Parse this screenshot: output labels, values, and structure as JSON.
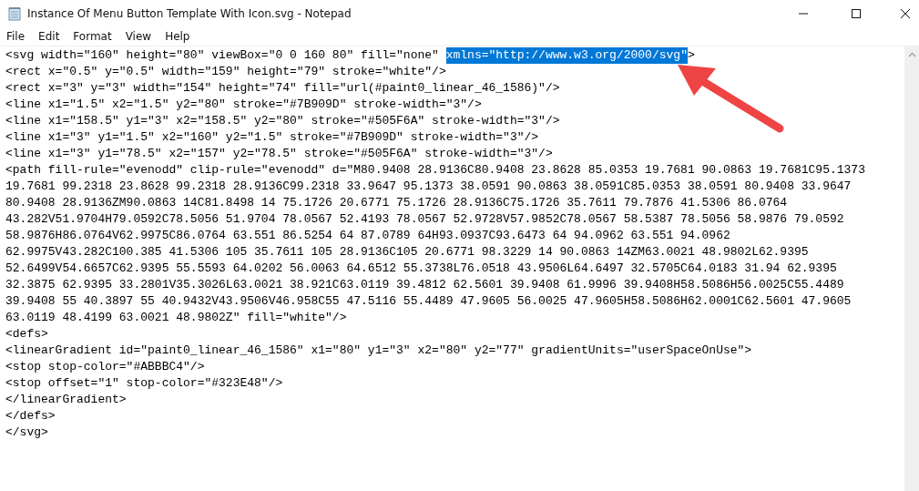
{
  "window": {
    "title": "Instance Of Menu Button Template With Icon.svg - Notepad"
  },
  "menu": [
    "File",
    "Edit",
    "Format",
    "View",
    "Help"
  ],
  "editor": {
    "lines": [
      {
        "segments": [
          {
            "text": "<svg width=\"160\" height=\"80\" viewBox=\"0 0 160 80\" fill=\"none\" ",
            "selected": false
          },
          {
            "text": "xmlns=\"http://www.w3.org/2000/svg\"",
            "selected": true
          },
          {
            "text": ">",
            "selected": false
          }
        ]
      },
      {
        "text": "<rect x=\"0.5\" y=\"0.5\" width=\"159\" height=\"79\" stroke=\"white\"/>"
      },
      {
        "text": "<rect x=\"3\" y=\"3\" width=\"154\" height=\"74\" fill=\"url(#paint0_linear_46_1586)\"/>"
      },
      {
        "text": "<line x1=\"1.5\" x2=\"1.5\" y2=\"80\" stroke=\"#7B909D\" stroke-width=\"3\"/>"
      },
      {
        "text": "<line x1=\"158.5\" y1=\"3\" x2=\"158.5\" y2=\"80\" stroke=\"#505F6A\" stroke-width=\"3\"/>"
      },
      {
        "text": "<line x1=\"3\" y1=\"1.5\" x2=\"160\" y2=\"1.5\" stroke=\"#7B909D\" stroke-width=\"3\"/>"
      },
      {
        "text": "<line x1=\"3\" y1=\"78.5\" x2=\"157\" y2=\"78.5\" stroke=\"#505F6A\" stroke-width=\"3\"/>"
      },
      {
        "text": "<path fill-rule=\"evenodd\" clip-rule=\"evenodd\" d=\"M80.9408 28.9136C80.9408 23.8628 85.0353 19.7681 90.0863 19.7681C95.1373"
      },
      {
        "text": "19.7681 99.2318 23.8628 99.2318 28.9136C99.2318 33.9647 95.1373 38.0591 90.0863 38.0591C85.0353 38.0591 80.9408 33.9647"
      },
      {
        "text": "80.9408 28.9136ZM90.0863 14C81.8498 14 75.1726 20.6771 75.1726 28.9136C75.1726 35.7611 79.7876 41.5306 86.0764"
      },
      {
        "text": "43.282V51.9704H79.0592C78.5056 51.9704 78.0567 52.4193 78.0567 52.9728V57.9852C78.0567 58.5387 78.5056 58.9876 79.0592"
      },
      {
        "text": "58.9876H86.0764V62.9975C86.0764 63.551 86.5254 64 87.0789 64H93.0937C93.6473 64 94.0962 63.551 94.0962"
      },
      {
        "text": "62.9975V43.282C100.385 41.5306 105 35.7611 105 28.9136C105 20.6771 98.3229 14 90.0863 14ZM63.0021 48.9802L62.9395"
      },
      {
        "text": "52.6499V54.6657C62.9395 55.5593 64.0202 56.0063 64.6512 55.3738L76.0518 43.9506L64.6497 32.5705C64.0183 31.94 62.9395"
      },
      {
        "text": "32.3875 62.9395 33.2801V35.3026L63.0021 38.921C63.0119 39.4812 62.5601 39.9408 61.9996 39.9408H58.5086H56.0025C55.4489"
      },
      {
        "text": "39.9408 55 40.3897 55 40.9432V43.9506V46.958C55 47.5116 55.4489 47.9605 56.0025 47.9605H58.5086H62.0001C62.5601 47.9605"
      },
      {
        "text": "63.0119 48.4199 63.0021 48.9802Z\" fill=\"white\"/>"
      },
      {
        "text": "<defs>"
      },
      {
        "text": "<linearGradient id=\"paint0_linear_46_1586\" x1=\"80\" y1=\"3\" x2=\"80\" y2=\"77\" gradientUnits=\"userSpaceOnUse\">"
      },
      {
        "text": "<stop stop-color=\"#ABBBC4\"/>"
      },
      {
        "text": "<stop offset=\"1\" stop-color=\"#323E48\"/>"
      },
      {
        "text": "</linearGradient>"
      },
      {
        "text": "</defs>"
      },
      {
        "text": "</svg>"
      }
    ]
  }
}
